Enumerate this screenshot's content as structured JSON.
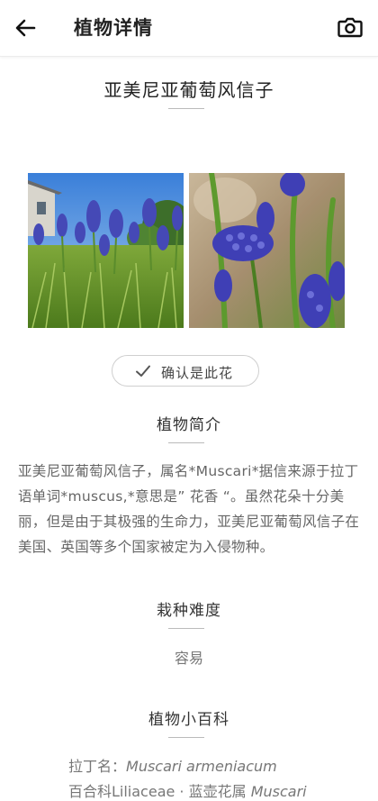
{
  "appbar": {
    "title": "植物详情",
    "back_icon": "arrow-left-icon",
    "camera_icon": "camera-icon"
  },
  "plant": {
    "name": "亚美尼亚葡萄风信子"
  },
  "photos": [
    {
      "alt_icon": "grape-hyacinth-field-photo"
    },
    {
      "alt_icon": "grape-hyacinth-closeup-photo"
    }
  ],
  "confirm": {
    "label": "确认是此花",
    "icon": "check-icon"
  },
  "intro": {
    "title": "植物简介",
    "text": "亚美尼亚葡萄风信子，属名*Muscari*据信来源于拉丁语单词*muscus,*意思是” 花香 “。虽然花朵十分美丽，但是由于其极强的生命力，亚美尼亚葡萄风信子在美国、英国等多个国家被定为入侵物种。"
  },
  "difficulty": {
    "title": "栽种难度",
    "value": "容易"
  },
  "encyclopedia": {
    "title": "植物小百科",
    "latin_label": "拉丁名：",
    "latin_value": "Muscari armeniacum",
    "family_text": "百合科Liliaceae · 蓝壶花属 ",
    "genus_value": "Muscari"
  },
  "colors": {
    "accent_flower": "#4a4fb8",
    "text_primary": "#222222",
    "text_muted": "#666666"
  }
}
